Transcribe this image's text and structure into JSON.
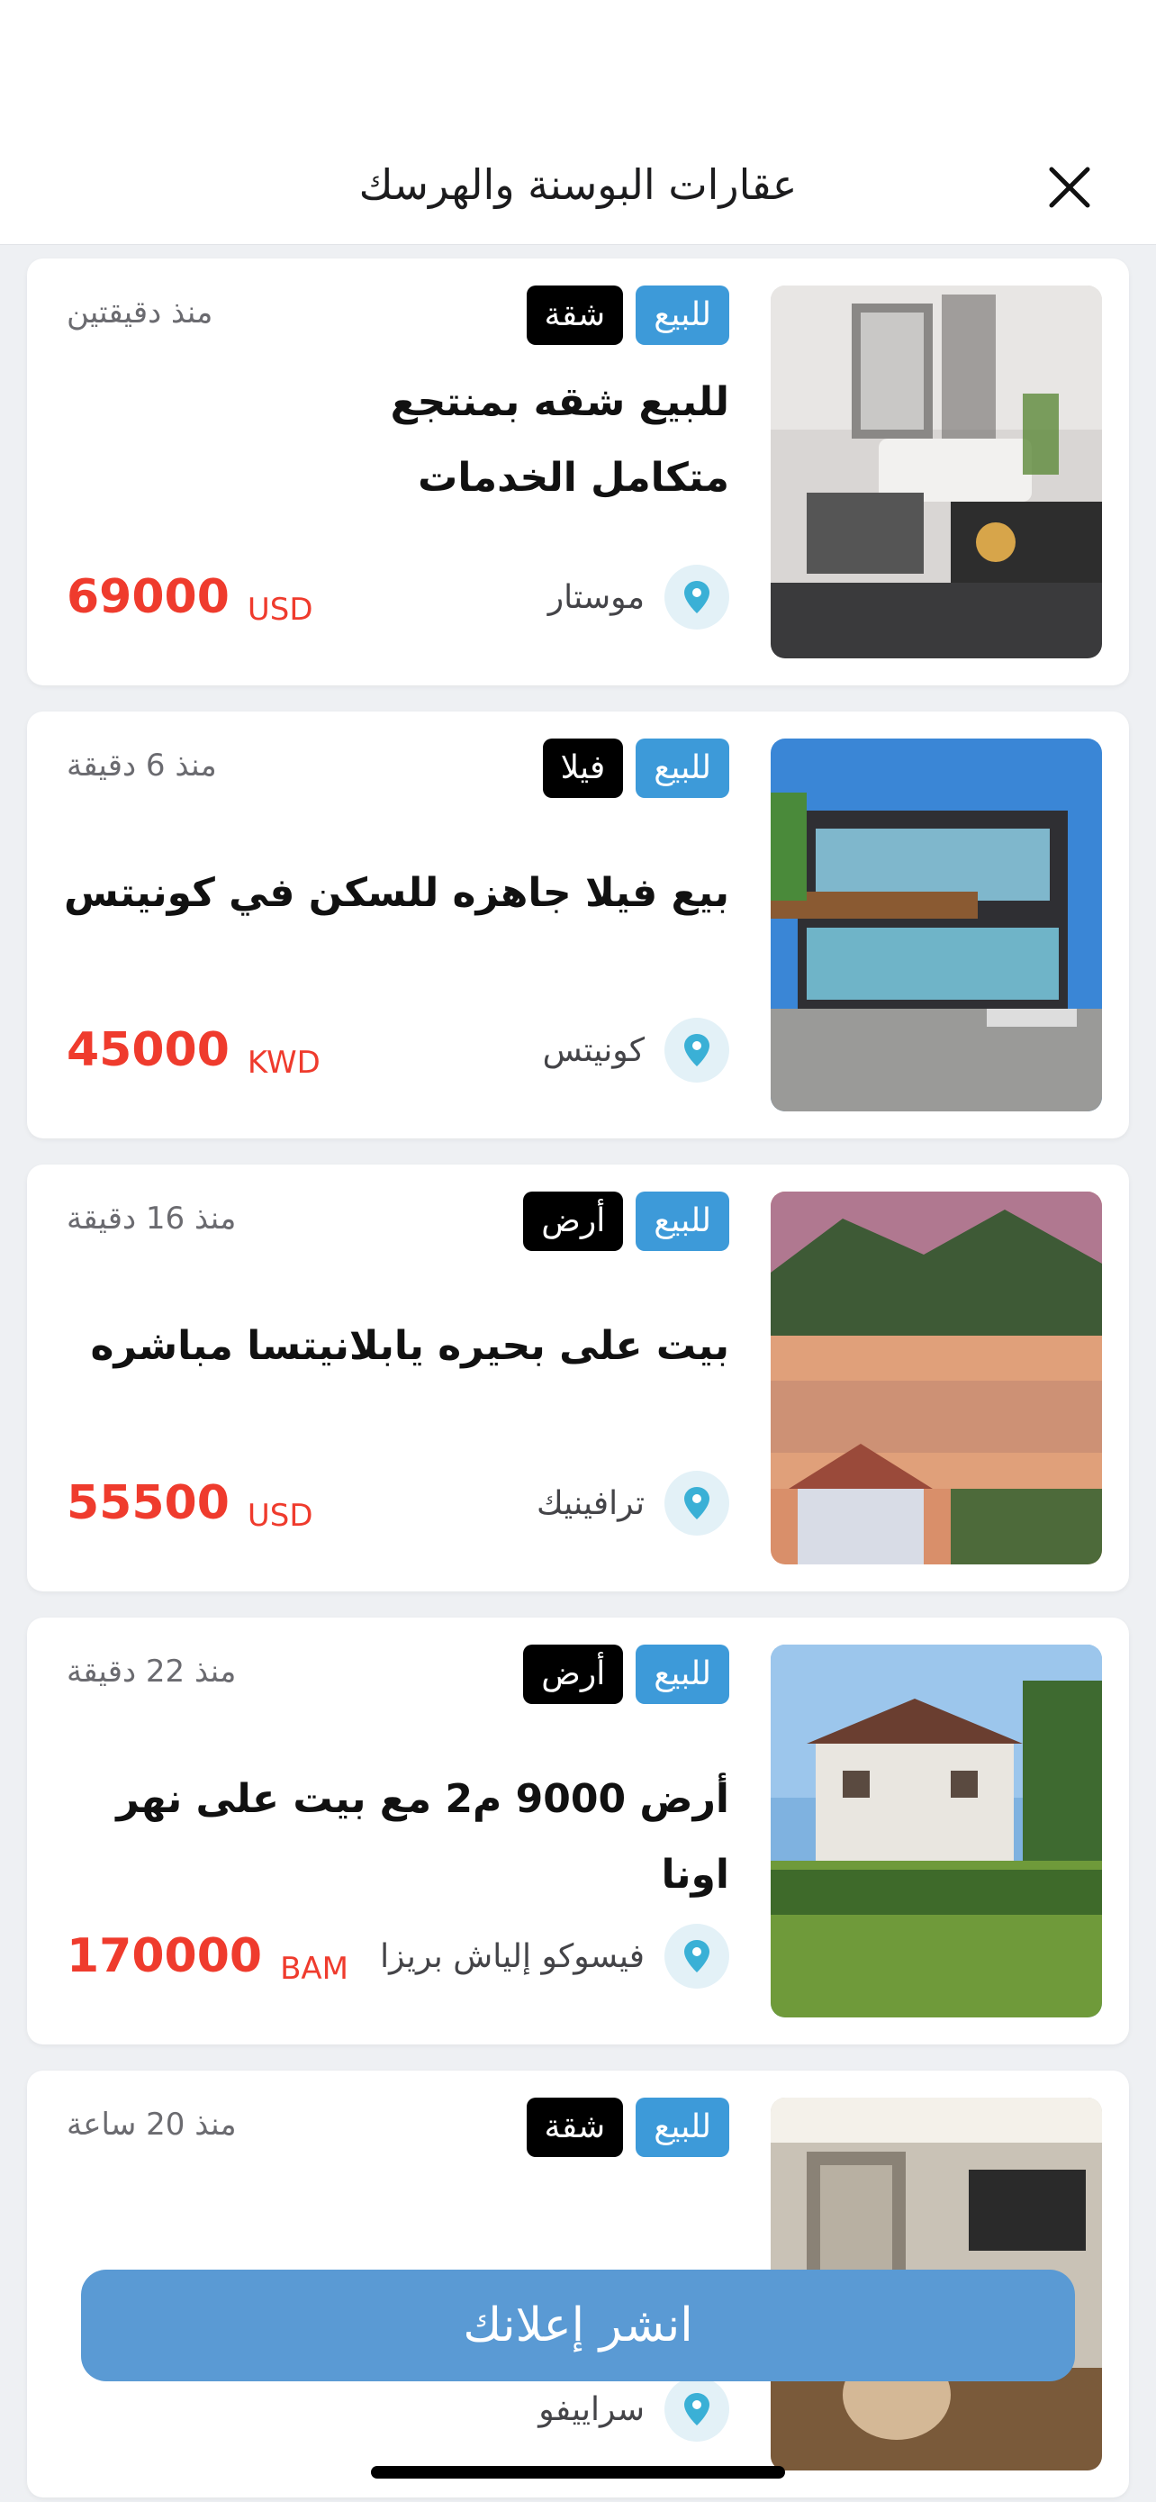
{
  "header": {
    "title": "عقارات البوسنة والهرسك",
    "close_icon": "close-icon"
  },
  "listings": [
    {
      "sale_tag": "للبيع",
      "type_tag": "شقة",
      "time": "منذ دقيقتين",
      "title_lines": [
        "للبيع شقه بمنتجع",
        "متكامل الخدمات"
      ],
      "location": "موستار",
      "price": "69000",
      "currency": "USD"
    },
    {
      "sale_tag": "للبيع",
      "type_tag": "فيلا",
      "time": "منذ 6 دقيقة",
      "title_lines": [
        "بيع فيلا جاهزه للسكن في كونيتس"
      ],
      "location": "كونيتس",
      "price": "45000",
      "currency": "KWD"
    },
    {
      "sale_tag": "للبيع",
      "type_tag": "أرض",
      "time": "منذ 16 دقيقة",
      "title_lines": [
        "بيت على بحيره يابلانيتسا مباشره"
      ],
      "location": "ترافينيك",
      "price": "55500",
      "currency": "USD"
    },
    {
      "sale_tag": "للبيع",
      "type_tag": "أرض",
      "time": "منذ 22 دقيقة",
      "title_lines": [
        "أرض 9000 م2 مع بيت على نهر اونا"
      ],
      "location": "فيسوكو إلياش بريزا",
      "price": "170000",
      "currency": "BAM"
    },
    {
      "sale_tag": "للبيع",
      "type_tag": "شقة",
      "time": "منذ 20 ساعة",
      "title_lines": [
        ""
      ],
      "location": "سراييفو",
      "price": "",
      "currency": ""
    }
  ],
  "post_button": {
    "label": "انشر إعلانك"
  },
  "colors": {
    "accent_blue": "#3d9ad9",
    "price_red": "#ef3b2d",
    "button_blue": "#5a9ad4"
  }
}
